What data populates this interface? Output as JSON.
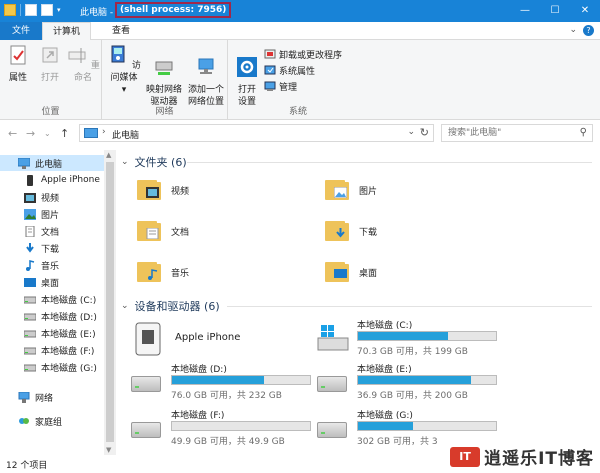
{
  "window": {
    "title": "此电脑 - ",
    "title_highlight": "(shell process: 7956)",
    "controls": [
      "—",
      "☐",
      "✕"
    ]
  },
  "ribbon_tabs": [
    {
      "label": "文件"
    },
    {
      "label": "计算机"
    },
    {
      "label": "查看"
    }
  ],
  "ribbon": {
    "groups": {
      "location": {
        "label": "位置",
        "buttons": [
          {
            "label": "属性",
            "icon": "properties-icon"
          },
          {
            "label": "打开",
            "icon": "open-icon"
          },
          {
            "label": "重命名",
            "icon": "rename-icon"
          }
        ]
      },
      "network": {
        "label": "网络",
        "buttons": [
          {
            "label": "访问媒体",
            "icon": "media-icon"
          },
          {
            "label": "映射网络\n驱动器",
            "icon": "map-drive-icon"
          },
          {
            "label": "添加一个\n网络位置",
            "icon": "network-location-icon"
          }
        ]
      },
      "system": {
        "label": "系统",
        "open_settings": "打开\n设置",
        "items": [
          {
            "label": "卸载或更改程序"
          },
          {
            "label": "系统属性"
          },
          {
            "label": "管理"
          }
        ]
      }
    }
  },
  "address": {
    "breadcrumb": "此电脑",
    "search_placeholder": "搜索\"此电脑\""
  },
  "sidebar": {
    "items": [
      {
        "label": "此电脑",
        "icon": "computer-icon",
        "selected": true
      },
      {
        "label": "Apple iPhone",
        "icon": "phone-icon"
      },
      {
        "label": "视频",
        "icon": "video-folder-icon"
      },
      {
        "label": "图片",
        "icon": "pictures-folder-icon"
      },
      {
        "label": "文档",
        "icon": "documents-folder-icon"
      },
      {
        "label": "下载",
        "icon": "download-icon"
      },
      {
        "label": "音乐",
        "icon": "music-icon"
      },
      {
        "label": "桌面",
        "icon": "desktop-folder-icon"
      },
      {
        "label": "本地磁盘 (C:)",
        "icon": "drive-icon"
      },
      {
        "label": "本地磁盘 (D:)",
        "icon": "drive-icon"
      },
      {
        "label": "本地磁盘 (E:)",
        "icon": "drive-icon"
      },
      {
        "label": "本地磁盘 (F:)",
        "icon": "drive-icon"
      },
      {
        "label": "本地磁盘 (G:)",
        "icon": "drive-icon"
      },
      {
        "label": "网络",
        "icon": "network-icon"
      },
      {
        "label": "家庭组",
        "icon": "homegroup-icon"
      }
    ]
  },
  "content": {
    "folders_header": "文件夹 (6)",
    "folders": [
      {
        "label": "视频",
        "icon": "video-folder-icon"
      },
      {
        "label": "图片",
        "icon": "pictures-folder-icon"
      },
      {
        "label": "文档",
        "icon": "documents-folder-icon"
      },
      {
        "label": "下载",
        "icon": "download-folder-icon"
      },
      {
        "label": "音乐",
        "icon": "music-folder-icon"
      },
      {
        "label": "桌面",
        "icon": "desktop-folder-icon"
      }
    ],
    "devices_header": "设备和驱动器 (6)",
    "devices": [
      {
        "name": "Apple iPhone",
        "icon": "iphone-device-icon"
      },
      {
        "name": "本地磁盘 (C:)",
        "info": "70.3 GB 可用，共 199 GB",
        "used_fraction": 0.65,
        "icon": "windows-drive-icon"
      },
      {
        "name": "本地磁盘 (D:)",
        "info": "76.0 GB 可用，共 232 GB",
        "used_fraction": 0.67,
        "icon": "drive-icon"
      },
      {
        "name": "本地磁盘 (E:)",
        "info": "36.9 GB 可用，共 200 GB",
        "used_fraction": 0.82,
        "icon": "drive-icon"
      },
      {
        "name": "本地磁盘 (F:)",
        "info": "49.9 GB 可用，共 49.9 GB",
        "used_fraction": 0.0,
        "icon": "drive-icon"
      },
      {
        "name": "本地磁盘 (G:)",
        "info": "302 GB 可用，共 3",
        "used_fraction": 0.4,
        "icon": "drive-icon"
      }
    ]
  },
  "status": {
    "item_count": "12 个项目"
  },
  "watermark": {
    "logo": "IT",
    "brand": "逍遥乐IT博客"
  },
  "colors": {
    "titlebar": "#1883d7",
    "file_tab": "#1979ca",
    "selected": "#cce8ff",
    "bar_fill": "#26a0da",
    "highlight_border": "#a0284a"
  }
}
